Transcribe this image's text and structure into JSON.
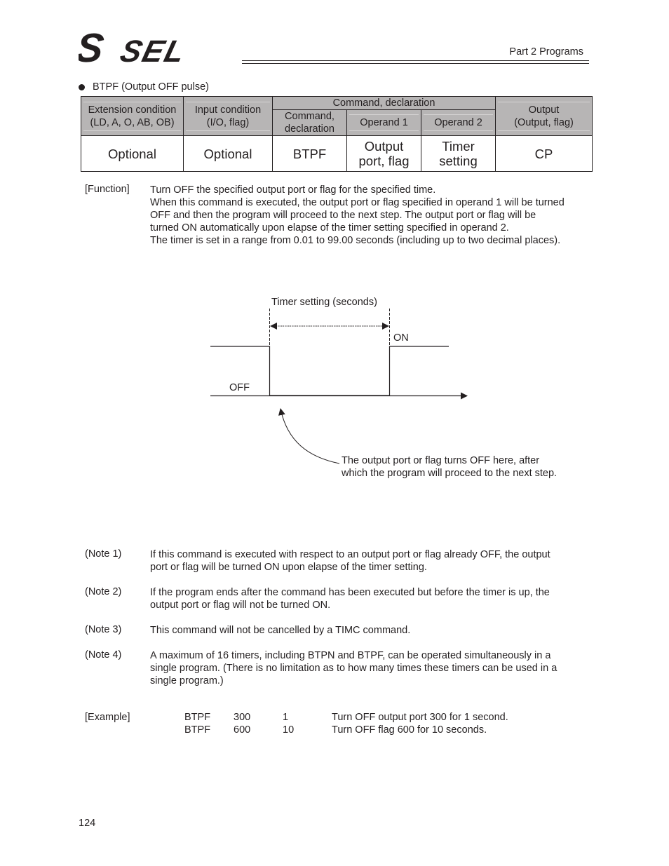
{
  "header": {
    "logo_text": "S SEL",
    "section": "Part 2 Programs"
  },
  "section_title": "BTPF (Output OFF pulse)",
  "spec_table": {
    "headers": {
      "extension_condition": [
        "Extension condition",
        "(LD, A, O, AB, OB)"
      ],
      "input_condition": [
        "Input condition",
        "(I/O, flag)"
      ],
      "command_group": "Command, declaration",
      "command": [
        "Command,",
        "declaration"
      ],
      "operand1": "Operand 1",
      "operand2": "Operand 2",
      "output": [
        "Output",
        "(Output, flag)"
      ]
    },
    "row": {
      "extension_condition": "Optional",
      "input_condition": "Optional",
      "command": "BTPF",
      "operand1": [
        "Output",
        "port, flag"
      ],
      "operand2": [
        "Timer",
        "setting"
      ],
      "output": "CP"
    }
  },
  "function": {
    "label": "[Function]",
    "lines": [
      "Turn OFF the specified output port or flag for the specified time.",
      "When this command is executed, the output port or flag specified in operand 1 will be turned",
      "OFF and then the program will proceed to the next step. The output port or flag will be",
      "turned ON automatically upon elapse of the timer setting specified in operand 2.",
      "The timer is set in a range from 0.01 to 99.00 seconds (including up to two decimal places)."
    ]
  },
  "diagram": {
    "timer_label": "Timer setting (seconds)",
    "on_label": "ON",
    "off_label": "OFF",
    "annotation": [
      "The output port or flag turns OFF here, after",
      "which the program will proceed to the next step."
    ]
  },
  "notes": [
    {
      "label": "(Note 1)",
      "lines": [
        "If this command is executed with respect to an output port or flag already OFF, the output",
        "port or flag will be turned ON upon elapse of the timer setting."
      ]
    },
    {
      "label": "(Note 2)",
      "lines": [
        "If the program ends after the command has been executed but before the timer is up, the",
        "output port or flag will not be turned ON."
      ]
    },
    {
      "label": "(Note 3)",
      "lines": [
        "This command will not be cancelled by a TIMC command."
      ]
    },
    {
      "label": "(Note 4)",
      "lines": [
        "A maximum of 16 timers, including BTPN and BTPF, can be operated simultaneously in a",
        "single program. (There is no limitation as to how many times these timers can be used in a",
        "single program.)"
      ]
    }
  ],
  "example": {
    "label": "[Example]",
    "rows": [
      {
        "command": "BTPF",
        "operand1": "300",
        "operand2": "1",
        "comment": "Turn OFF output port 300 for 1 second."
      },
      {
        "command": "BTPF",
        "operand1": "600",
        "operand2": "10",
        "comment": "Turn OFF flag 600 for 10 seconds."
      }
    ]
  },
  "page_number": "124"
}
